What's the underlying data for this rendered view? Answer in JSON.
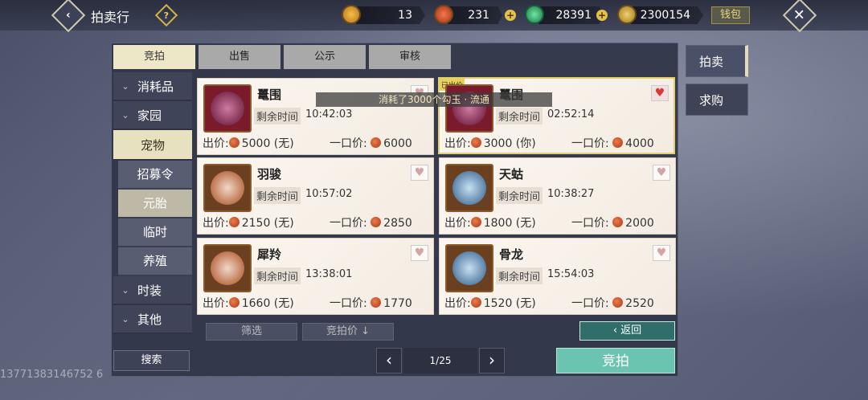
{
  "header": {
    "title": "拍卖行",
    "help_icon": "?",
    "currencies": [
      {
        "name": "gold-ingot",
        "value": "13",
        "color": "#e4a43a"
      },
      {
        "name": "red-jade",
        "value": "231",
        "color": "#d0502e"
      },
      {
        "name": "green-jade",
        "value": "28391",
        "color": "#3ea26a"
      },
      {
        "name": "gold-leaf",
        "value": "2300154",
        "color": "#c9a036"
      }
    ],
    "wallet_label": "钱包"
  },
  "tabs": [
    "竞拍",
    "出售",
    "公示",
    "审核"
  ],
  "sidebar": {
    "items": [
      {
        "label": "消耗品"
      },
      {
        "label": "家园"
      },
      {
        "label": "宠物"
      }
    ],
    "subitems": [
      "招募令",
      "元胎",
      "临时",
      "养殖"
    ],
    "items_after": [
      {
        "label": "时装"
      },
      {
        "label": "其他"
      }
    ],
    "search_label": "搜索"
  },
  "toast": "消耗了3000个勾玉 · 流通",
  "cards": [
    {
      "name": "鼍围",
      "remain_label": "剩余时间",
      "remain": "10:42:03",
      "bid_label": "出价:",
      "bid": "5000 (无)",
      "buy_label": "一口价:",
      "buy": "6000",
      "heart": false,
      "orb": "#8a2030"
    },
    {
      "name": "鼍围",
      "remain_label": "剩余时间",
      "remain": "02:52:14",
      "bid_label": "出价:",
      "bid": "3000 (你)",
      "buy_label": "一口价:",
      "buy": "4000",
      "heart": true,
      "tag": "已出价",
      "orb": "#8a2030"
    },
    {
      "name": "羽骏",
      "remain_label": "剩余时间",
      "remain": "10:57:02",
      "bid_label": "出价:",
      "bid": "2150 (无)",
      "buy_label": "一口价:",
      "buy": "2850",
      "heart": false,
      "orb": "#b8863a"
    },
    {
      "name": "天蛄",
      "remain_label": "剩余时间",
      "remain": "10:38:27",
      "bid_label": "出价:",
      "bid": "1800 (无)",
      "buy_label": "一口价:",
      "buy": "2000",
      "heart": false,
      "orb": "#4a78a8"
    },
    {
      "name": "犀羚",
      "remain_label": "剩余时间",
      "remain": "13:38:01",
      "bid_label": "出价:",
      "bid": "1660 (无)",
      "buy_label": "一口价:",
      "buy": "1770",
      "heart": false,
      "orb": "#b8863a"
    },
    {
      "name": "骨龙",
      "remain_label": "剩余时间",
      "remain": "15:54:03",
      "bid_label": "出价:",
      "bid": "1520 (无)",
      "buy_label": "一口价:",
      "buy": "2520",
      "heart": false,
      "orb": "#4a78a8"
    }
  ],
  "controls": {
    "filter": "筛选",
    "sort": "竞拍价 ↓",
    "return": "返回",
    "page": "1/25",
    "bid_button": "竞拍"
  },
  "right_tabs": [
    "拍卖",
    "求购"
  ],
  "watermark": "13771383146752 6"
}
